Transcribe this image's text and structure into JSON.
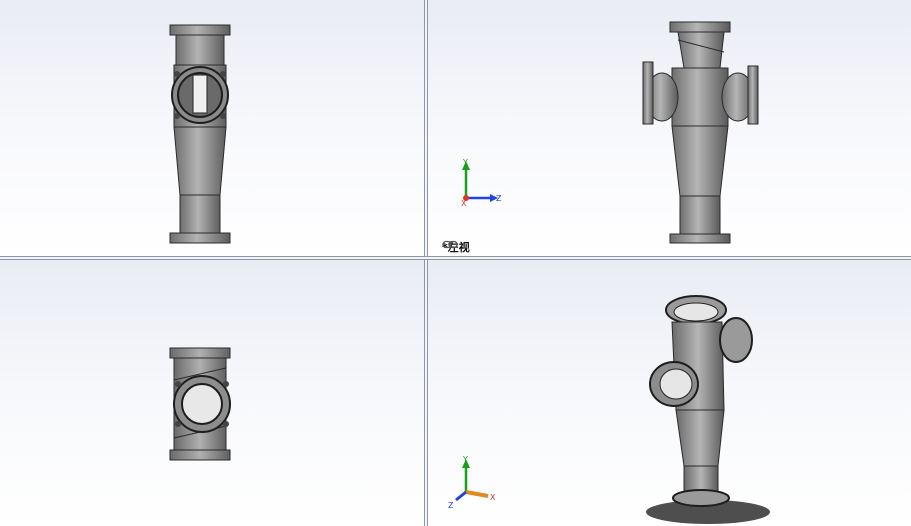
{
  "viewports": {
    "top_left": {
      "name": ""
    },
    "top_right": {
      "name": "*左视"
    },
    "bottom_left": {
      "name": ""
    },
    "bottom_right": {
      "name": ""
    }
  },
  "triads": {
    "left_view": {
      "axes": [
        "Y",
        "Z",
        "X"
      ]
    },
    "iso_view": {
      "axes": [
        "Y",
        "X",
        "Z"
      ]
    }
  },
  "colors": {
    "model_grey": "#a3a3a3",
    "model_dark": "#2b2b2b",
    "axis_y": "#19a019",
    "axis_z": "#2244dd",
    "axis_x": "#dd3322",
    "divider": "#8e96a6"
  },
  "icons": [
    "chain-link-icon",
    "view-triad-icon"
  ]
}
